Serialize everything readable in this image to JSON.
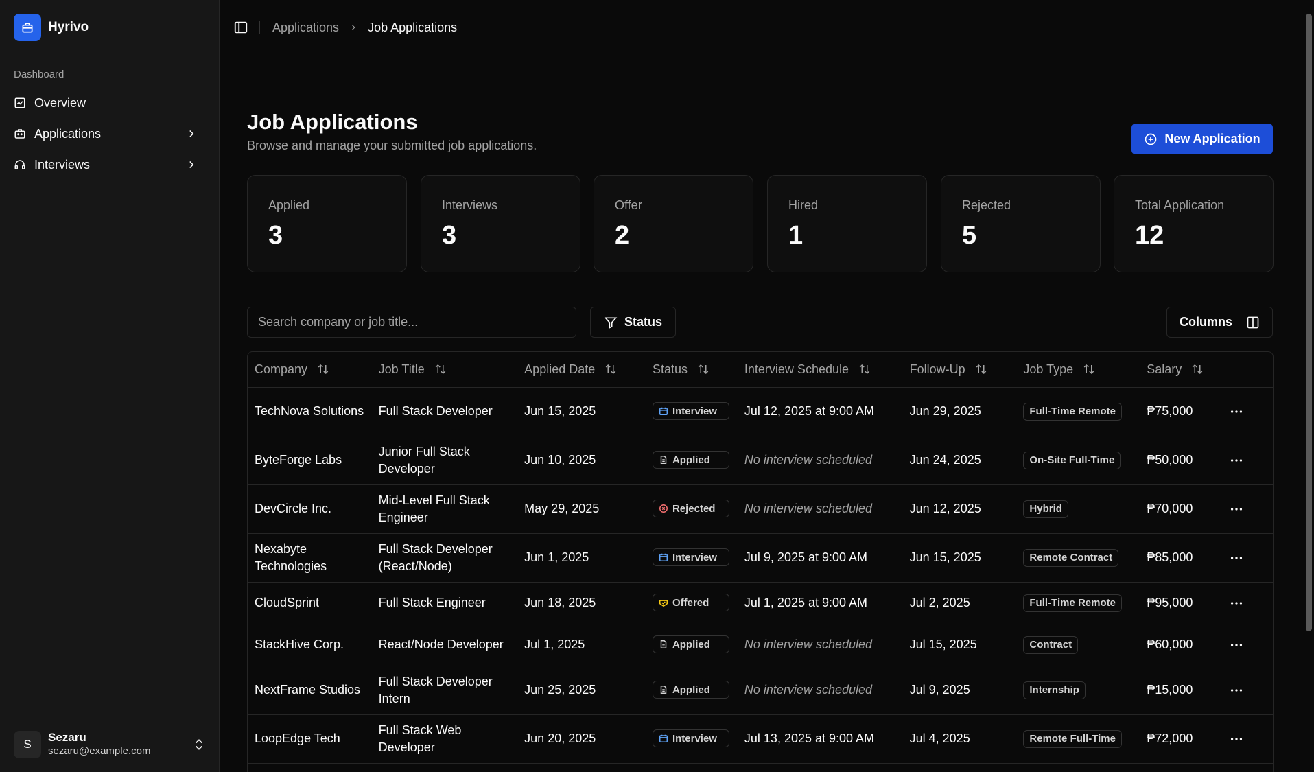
{
  "brand": {
    "name": "Hyrivo"
  },
  "sidebar": {
    "group_label": "Dashboard",
    "items": [
      {
        "label": "Overview",
        "icon": "chart-icon"
      },
      {
        "label": "Applications",
        "icon": "briefcase-icon"
      },
      {
        "label": "Interviews",
        "icon": "headset-icon"
      }
    ]
  },
  "user": {
    "initial": "S",
    "name": "Sezaru",
    "email": "sezaru@example.com"
  },
  "breadcrumb": {
    "parent": "Applications",
    "current": "Job Applications"
  },
  "header": {
    "title": "Job Applications",
    "subtitle": "Browse and manage your submitted job applications.",
    "new_button": "New Application"
  },
  "stats": [
    {
      "label": "Applied",
      "value": "3"
    },
    {
      "label": "Interviews",
      "value": "3"
    },
    {
      "label": "Offer",
      "value": "2"
    },
    {
      "label": "Hired",
      "value": "1"
    },
    {
      "label": "Rejected",
      "value": "5"
    },
    {
      "label": "Total Application",
      "value": "12"
    }
  ],
  "toolbar": {
    "search_placeholder": "Search company or job title...",
    "status_label": "Status",
    "columns_label": "Columns"
  },
  "table": {
    "headers": [
      "Company",
      "Job Title",
      "Applied Date",
      "Status",
      "Interview Schedule",
      "Follow-Up",
      "Job Type",
      "Salary"
    ],
    "rows": [
      {
        "company": "TechNova Solutions",
        "title": "Full Stack Developer",
        "applied": "Jun 15, 2025",
        "status": "Interview",
        "schedule": "Jul 12, 2025 at 9:00 AM",
        "followup": "Jun 29, 2025",
        "type": "Full-Time Remote",
        "salary": "₱75,000"
      },
      {
        "company": "ByteForge Labs",
        "title": "Junior Full Stack Developer",
        "applied": "Jun 10, 2025",
        "status": "Applied",
        "schedule": "No interview scheduled",
        "followup": "Jun 24, 2025",
        "type": "On-Site Full-Time",
        "salary": "₱50,000"
      },
      {
        "company": "DevCircle Inc.",
        "title": "Mid-Level Full Stack Engineer",
        "applied": "May 29, 2025",
        "status": "Rejected",
        "schedule": "No interview scheduled",
        "followup": "Jun 12, 2025",
        "type": "Hybrid",
        "salary": "₱70,000"
      },
      {
        "company": "Nexabyte Technologies",
        "title": "Full Stack Developer (React/Node)",
        "applied": "Jun 1, 2025",
        "status": "Interview",
        "schedule": "Jul 9, 2025 at 9:00 AM",
        "followup": "Jun 15, 2025",
        "type": "Remote Contract",
        "salary": "₱85,000"
      },
      {
        "company": "CloudSprint",
        "title": "Full Stack Engineer",
        "applied": "Jun 18, 2025",
        "status": "Offered",
        "schedule": "Jul 1, 2025 at 9:00 AM",
        "followup": "Jul 2, 2025",
        "type": "Full-Time Remote",
        "salary": "₱95,000"
      },
      {
        "company": "StackHive Corp.",
        "title": "React/Node Developer",
        "applied": "Jul 1, 2025",
        "status": "Applied",
        "schedule": "No interview scheduled",
        "followup": "Jul 15, 2025",
        "type": "Contract",
        "salary": "₱60,000"
      },
      {
        "company": "NextFrame Studios",
        "title": "Full Stack Developer Intern",
        "applied": "Jun 25, 2025",
        "status": "Applied",
        "schedule": "No interview scheduled",
        "followup": "Jul 9, 2025",
        "type": "Internship",
        "salary": "₱15,000"
      },
      {
        "company": "LoopEdge Tech",
        "title": "Full Stack Web Developer",
        "applied": "Jun 20, 2025",
        "status": "Interview",
        "schedule": "Jul 13, 2025 at 9:00 AM",
        "followup": "Jul 4, 2025",
        "type": "Remote Full-Time",
        "salary": "₱72,000"
      }
    ]
  },
  "colors": {
    "accent": "#2563eb",
    "interview": "#60a5fa",
    "rejected": "#f87171",
    "offered": "#facc15",
    "applied": "#d4d4d4"
  }
}
